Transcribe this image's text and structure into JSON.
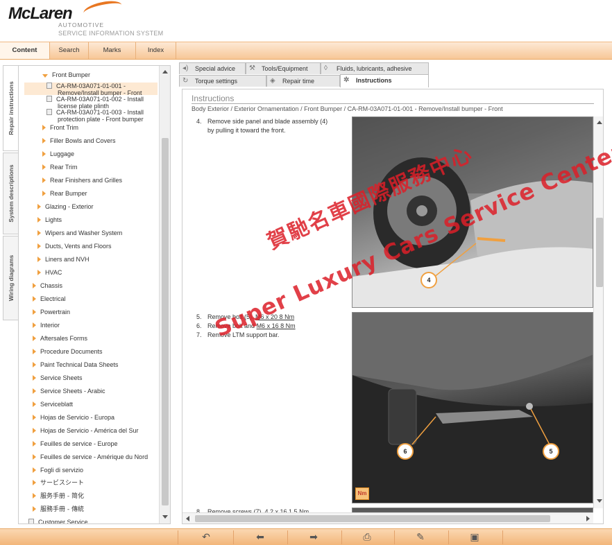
{
  "header": {
    "logo_text": "McLaren",
    "logo_sub": "AUTOMOTIVE",
    "system_name": "SERVICE INFORMATION SYSTEM"
  },
  "topnav": [
    "Content",
    "Search",
    "Marks",
    "Index"
  ],
  "side_tabs": [
    "Repair instructions",
    "System descriptions",
    "Wiring diagrams"
  ],
  "tree": {
    "front_bumper": "Front Bumper",
    "docs": [
      [
        "CA-RM-03A071-01-001 -",
        "Remove/Install bumper - Front"
      ],
      [
        "CA-RM-03A071-01-002 - Install",
        "license plate plinth"
      ],
      [
        "CA-RM-03A071-01-003 - Install",
        "protection plate - Front bumper"
      ]
    ],
    "level3": [
      "Front Trim",
      "Filler Bowls and Covers",
      "Luggage",
      "Rear Trim",
      "Rear Finishers and Grilles",
      "Rear Bumper"
    ],
    "level2": [
      "Glazing - Exterior",
      "Lights",
      "Wipers and Washer System",
      "Ducts, Vents and Floors",
      "Liners and NVH",
      "HVAC"
    ],
    "level1": [
      "Chassis",
      "Electrical",
      "Powertrain",
      "Interior",
      "Aftersales Forms",
      "Procedure Documents",
      "Paint Technical Data Sheets",
      "Service Sheets",
      "Service Sheets - Arabic",
      "Serviceblatt",
      "Hojas de Servicio - Europa",
      "Hojas de Servicio - América del Sur",
      "Feuilles de service - Europe",
      "Feuilles de service - Amérique du Nord",
      "Fogli di servizio",
      "サービスシート",
      "服务手册 - 简化",
      "服務手冊 - 傳統"
    ],
    "last": "Customer Service"
  },
  "tabs": {
    "row1": [
      "Special advice",
      "Tools/Equipment",
      "Fluids, lubricants, adhesive"
    ],
    "row2": [
      "Torque settings",
      "Repair time",
      "Instructions"
    ]
  },
  "content": {
    "title": "Instructions",
    "breadcrumb": "Body Exterior / Exterior Ornamentation / Front Bumper / CA-RM-03A071-01-001 - Remove/Install bumper - Front",
    "step4_num": "4.",
    "step4_line1": "Remove side panel and blade assembly (4)",
    "step4_line2": "by pulling it toward the front.",
    "step5_num": "5.",
    "step5_text": "Remove bolt (5).",
    "step5_spec": "M6 x 20 8 Nm",
    "step6_num": "6.",
    "step6_text": "Remove bolt and",
    "step6_spec": "M6 x 16 8 Nm",
    "step7_num": "7.",
    "step7_text": "Remove LTM support bar.",
    "step8_num": "8.",
    "step8_text": "Remove screws (7).",
    "step8_spec": "4.2 x 16 1.5 Nm",
    "callouts": [
      "4",
      "6",
      "5"
    ],
    "nm_badge": "Nm"
  },
  "watermark": {
    "cn": "賀馳名車國際服務中心",
    "en": "Super Luxury Cars Service Center"
  },
  "bottombar": {
    "buttons": [
      "back-icon",
      "previous-icon",
      "next-icon",
      "print-icon",
      "pin-icon",
      "window-icon"
    ]
  },
  "colors": {
    "accent_orange": "#f0a040",
    "nav_bg": "#f7c797",
    "watermark_red": "#dc1e28",
    "selection_bg": "#fde9d3"
  }
}
